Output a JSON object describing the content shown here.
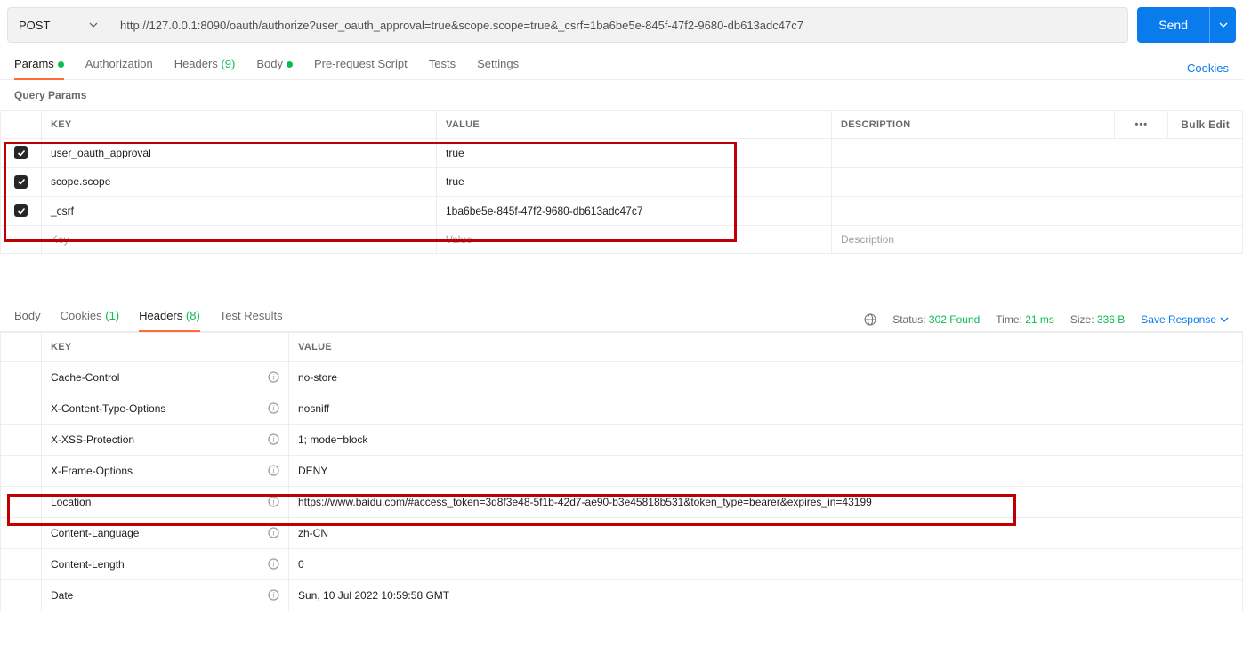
{
  "request": {
    "method": "POST",
    "url": "http://127.0.0.1:8090/oauth/authorize?user_oauth_approval=true&scope.scope=true&_csrf=1ba6be5e-845f-47f2-9680-db613adc47c7",
    "send_label": "Send"
  },
  "tabs": {
    "params": "Params",
    "authorization": "Authorization",
    "headers": "Headers",
    "headers_count": "(9)",
    "body": "Body",
    "prerequest": "Pre-request Script",
    "tests": "Tests",
    "settings": "Settings",
    "cookies": "Cookies"
  },
  "query_params": {
    "title": "Query Params",
    "key_header": "KEY",
    "value_header": "VALUE",
    "desc_header": "DESCRIPTION",
    "bulk_edit": "Bulk Edit",
    "key_placeholder": "Key",
    "value_placeholder": "Value",
    "desc_placeholder": "Description",
    "rows": [
      {
        "key": "user_oauth_approval",
        "value": "true"
      },
      {
        "key": "scope.scope",
        "value": "true"
      },
      {
        "key": "_csrf",
        "value": "1ba6be5e-845f-47f2-9680-db613adc47c7"
      }
    ]
  },
  "response_tabs": {
    "body": "Body",
    "cookies": "Cookies",
    "cookies_count": "(1)",
    "headers": "Headers",
    "headers_count": "(8)",
    "test_results": "Test Results"
  },
  "response_meta": {
    "status_label": "Status:",
    "status_value": "302 Found",
    "time_label": "Time:",
    "time_value": "21 ms",
    "size_label": "Size:",
    "size_value": "336 B",
    "save_response": "Save Response"
  },
  "response_headers": {
    "key_header": "KEY",
    "value_header": "VALUE",
    "rows": [
      {
        "key": "Cache-Control",
        "value": "no-store"
      },
      {
        "key": "X-Content-Type-Options",
        "value": "nosniff"
      },
      {
        "key": "X-XSS-Protection",
        "value": "1; mode=block"
      },
      {
        "key": "X-Frame-Options",
        "value": "DENY"
      },
      {
        "key": "Location",
        "value": "https://www.baidu.com/#access_token=3d8f3e48-5f1b-42d7-ae90-b3e45818b531&token_type=bearer&expires_in=43199"
      },
      {
        "key": "Content-Language",
        "value": "zh-CN"
      },
      {
        "key": "Content-Length",
        "value": "0"
      },
      {
        "key": "Date",
        "value": "Sun, 10 Jul 2022 10:59:58 GMT"
      }
    ]
  }
}
